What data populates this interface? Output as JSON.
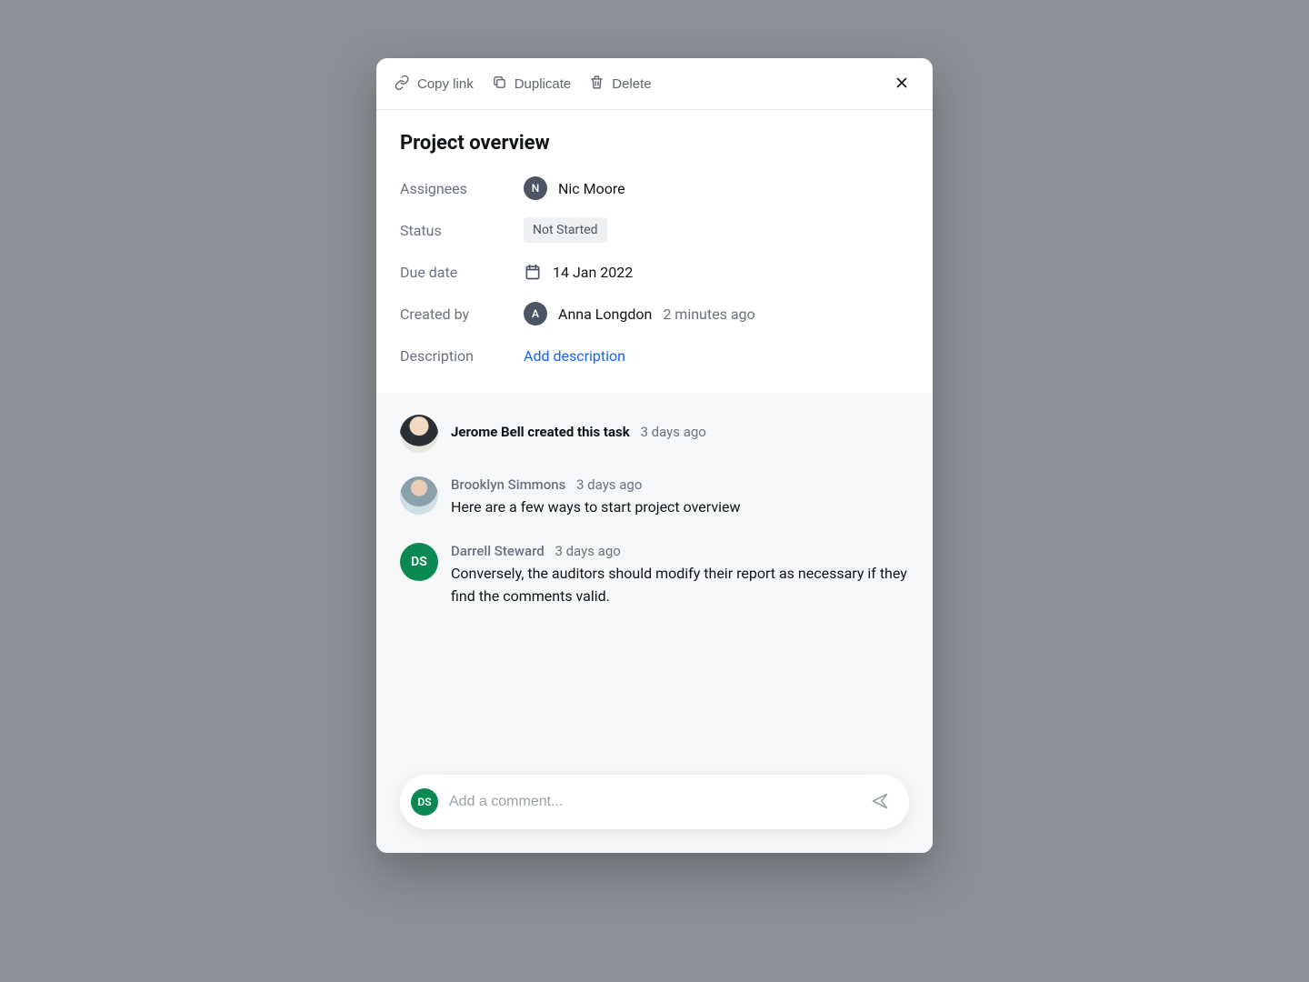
{
  "toolbar": {
    "copy_link": "Copy link",
    "duplicate": "Duplicate",
    "delete": "Delete"
  },
  "title": "Project overview",
  "fields": {
    "assignees_label": "Assignees",
    "assignee_initial": "N",
    "assignee_name": "Nic Moore",
    "status_label": "Status",
    "status_value": "Not Started",
    "due_label": "Due date",
    "due_value": "14 Jan 2022",
    "created_label": "Created by",
    "creator_initial": "A",
    "creator_name": "Anna Longdon",
    "created_time": "2 minutes ago",
    "description_label": "Description",
    "description_action": "Add description"
  },
  "activity": [
    {
      "type": "event",
      "avatar_label": "",
      "line": "Jerome Bell created this task",
      "time": "3 days ago"
    },
    {
      "type": "comment",
      "avatar_label": "",
      "author": "Brooklyn Simmons",
      "time": "3 days ago",
      "text": "Here are a few ways to start project overview"
    },
    {
      "type": "comment",
      "avatar_label": "DS",
      "author": "Darrell Steward",
      "time": "3 days ago",
      "text": "Conversely, the auditors should modify their report as necessary if they find the comments valid."
    }
  ],
  "composer": {
    "avatar_label": "DS",
    "placeholder": "Add a comment..."
  }
}
